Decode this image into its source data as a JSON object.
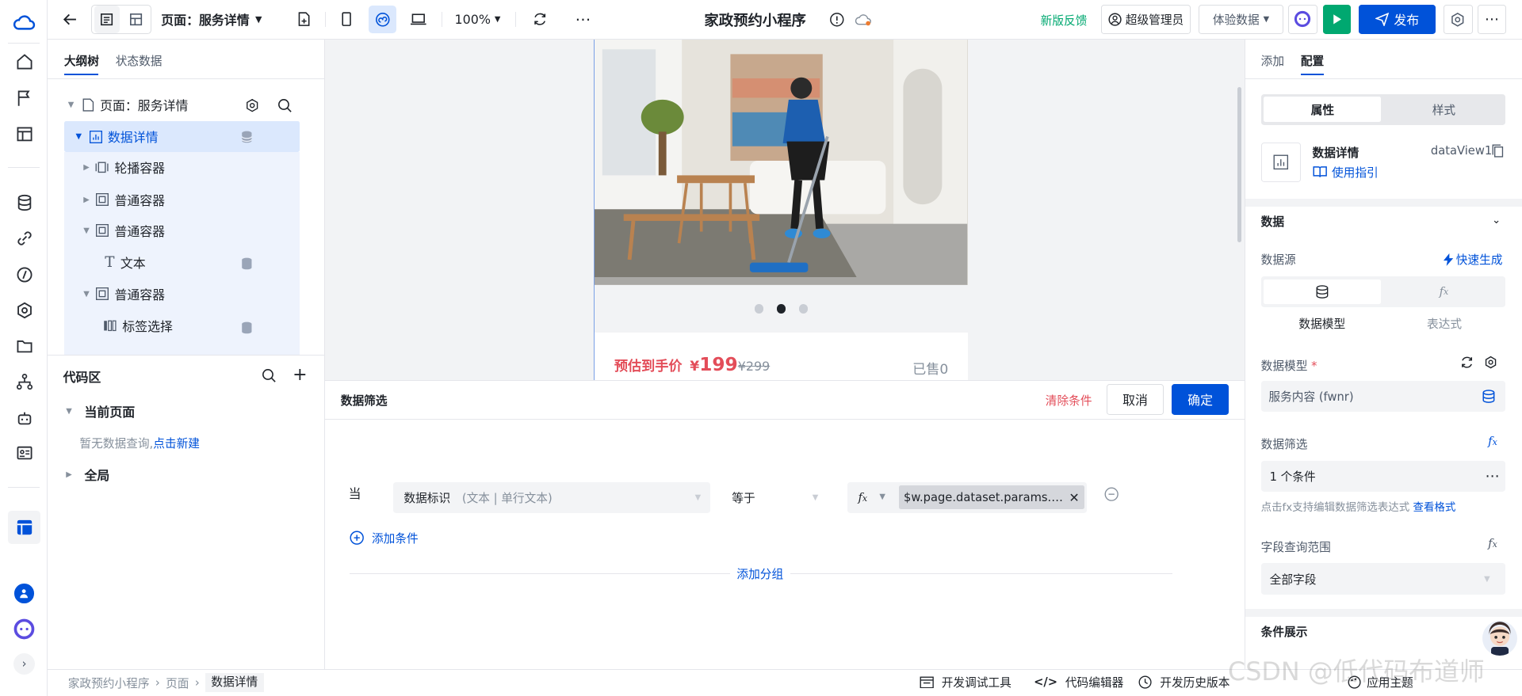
{
  "topbar": {
    "page_selector": "页面：服务详情",
    "zoom": "100%",
    "app_title": "家政预约小程序",
    "feedback": "新版反馈",
    "admin": "超级管理员",
    "exp_data": "体验数据",
    "publish": "发布"
  },
  "left_panel": {
    "tab_outline": "大纲树",
    "tab_state": "状态数据",
    "tree": [
      {
        "label": "页面：服务详情"
      },
      {
        "label": "数据详情"
      },
      {
        "label": "轮播容器"
      },
      {
        "label": "普通容器"
      },
      {
        "label": "普通容器"
      },
      {
        "label": "文本"
      },
      {
        "label": "普通容器"
      },
      {
        "label": "标签选择"
      }
    ],
    "code_area": "代码区",
    "current_page": "当前页面",
    "no_query": "暂无数据查询,",
    "new_link": "点击新建",
    "global": "全局"
  },
  "canvas": {
    "price_label": "预估到手价",
    "price_currency": "¥",
    "price_value": "199",
    "orig_price": "¥299",
    "sold": "已售0"
  },
  "filter": {
    "title": "数据筛选",
    "clear": "清除条件",
    "cancel": "取消",
    "confirm": "确定",
    "when": "当",
    "field_name": "数据标识",
    "field_type": "(文本 | 单行文本)",
    "operator": "等于",
    "value": "$w.page.dataset.params.ser...",
    "add_condition": "添加条件",
    "add_group": "添加分组"
  },
  "right_panel": {
    "tab_add": "添加",
    "tab_config": "配置",
    "seg_props": "属性",
    "seg_style": "样式",
    "comp_name": "数据详情",
    "comp_id": "dataView1",
    "usage": "使用指引",
    "section_data": "数据",
    "data_source": "数据源",
    "quick_gen": "快速生成",
    "src_model": "数据模型",
    "src_expr": "表达式",
    "model_label": "数据模型",
    "required_mark": "*",
    "model_value": "服务内容 (fwnr)",
    "filter_label": "数据筛选",
    "filter_value": "1 个条件",
    "filter_hint": "点击fx支持编辑数据筛选表达式",
    "view_format": "查看格式",
    "scope_label": "字段查询范围",
    "scope_value": "全部字段",
    "cond_display": "条件展示"
  },
  "statusbar": {
    "breadcrumb": [
      "家政预约小程序",
      "页面",
      "数据详情"
    ],
    "debug": "开发调试工具",
    "code_editor": "代码编辑器",
    "history": "开发历史版本",
    "theme": "应用主题",
    "watermark": "CSDN @低代码布道师"
  },
  "colors": {
    "accent": "#0052d9",
    "price": "#e34d59",
    "green": "#00a870",
    "selection": "#dbe8fd"
  }
}
